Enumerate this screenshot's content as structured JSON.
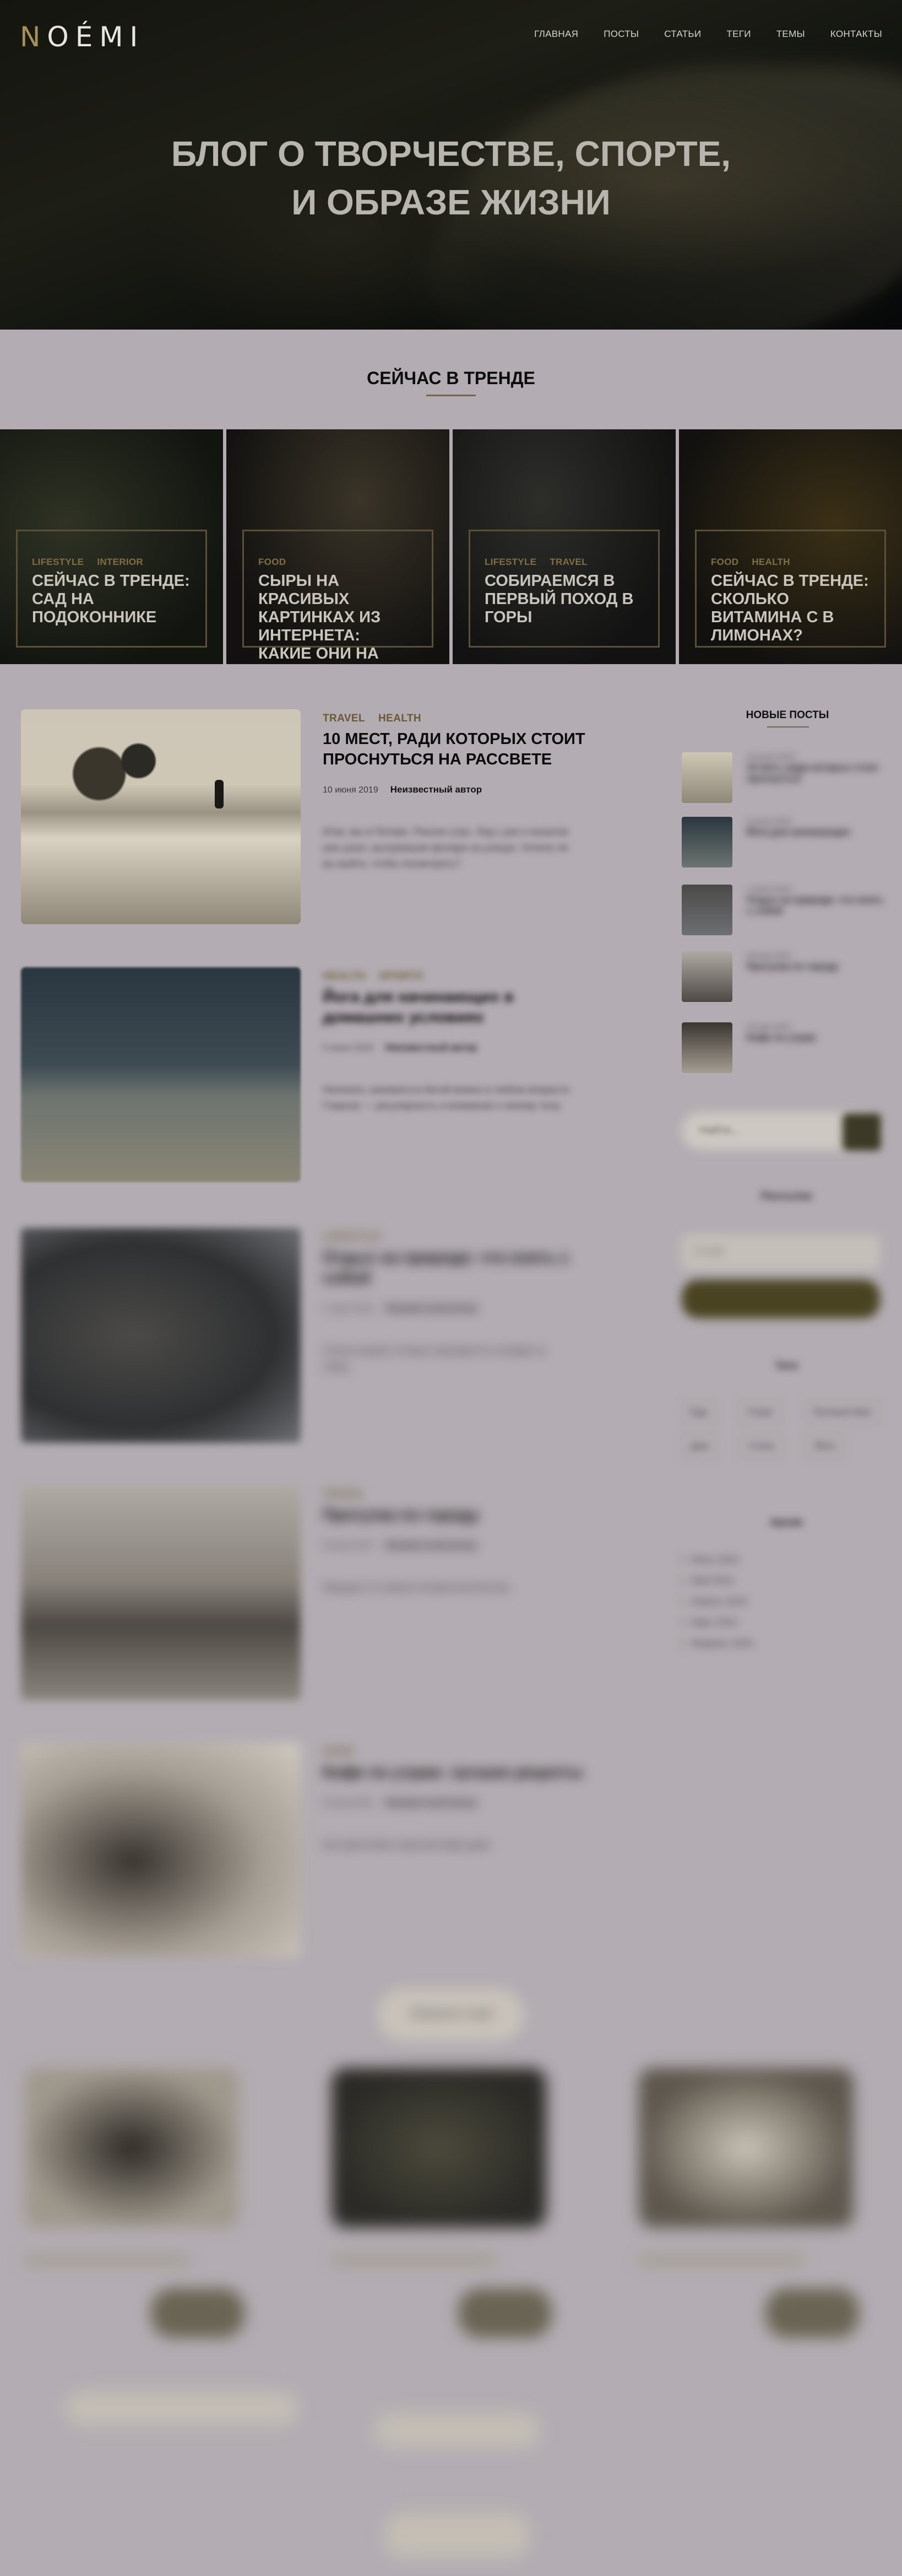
{
  "site": {
    "logo_first": "N",
    "logo_rest": "OÉMI"
  },
  "nav": [
    "ГЛАВНАЯ",
    "ПОСТЫ",
    "СТАТЬИ",
    "ТЕГИ",
    "ТЕМЫ",
    "КОНТАКТЫ"
  ],
  "hero": {
    "line1": "БЛОГ О ТВОРЧЕСТВЕ, СПОРТЕ,",
    "line2": "И ОБРАЗЕ ЖИЗНИ"
  },
  "trending": {
    "heading": "СЕЙЧАС В ТРЕНДЕ",
    "cards": [
      {
        "cats": [
          "LIFESTYLE",
          "INTERIOR"
        ],
        "title": "СЕЙЧАС В ТРЕНДЕ: САД НА ПОДОКОННИКЕ"
      },
      {
        "cats": [
          "FOOD"
        ],
        "title": "СЫРЫ НА КРАСИВЫХ КАРТИНКАХ ИЗ ИНТЕРНЕТА: КАКИЕ ОНИ НА ВКУС?"
      },
      {
        "cats": [
          "LIFESTYLE",
          "TRAVEL"
        ],
        "title": "СОБИРАЕМСЯ В ПЕРВЫЙ ПОХОД В ГОРЫ"
      },
      {
        "cats": [
          "FOOD",
          "HEALTH"
        ],
        "title": "СЕЙЧАС В ТРЕНДЕ: СКОЛЬКО ВИТАМИНА С В ЛИМОНАХ?"
      }
    ]
  },
  "posts": [
    {
      "cats": [
        "TRAVEL",
        "HEALTH"
      ],
      "title": "10 МЕСТ, РАДИ КОТОРЫХ СТОИТ ПРОСНУТЬСЯ НА РАССВЕТЕ",
      "date": "10 июня 2019",
      "author": "Неизвестный автор",
      "excerpt": "Итак, мы в Питере. Раннее утро. Лед с рек и каналов уже ушел, выгоревшие фонари на улицах. Успели ли вы выйти, чтобы посмотреть?"
    },
    {
      "cats": [
        "HEALTH",
        "SPORTS"
      ],
      "title": "Йога для начинающих в домашних условиях",
      "date": "5 июня 2019",
      "author": "Неизвестный автор",
      "excerpt": "Начинать заниматься йогой можно в любом возрасте. Главное — регулярность и внимание к своему телу."
    },
    {
      "cats": [
        "LIFESTYLE"
      ],
      "title": "Отдых на природе: что взять с собой",
      "date": "1 июня 2019",
      "author": "Неизвестный автор",
      "excerpt": "Список вещей, которые пригодятся в поездке за город."
    },
    {
      "cats": [
        "TRAVEL"
      ],
      "title": "Прогулка по городу",
      "date": "28 мая 2019",
      "author": "Неизвестный автор",
      "excerpt": "Маршрут по самым интересным местам."
    },
    {
      "cats": [
        "FOOD"
      ],
      "title": "Кофе по утрам: лучшие рецепты",
      "date": "20 мая 2019",
      "author": "Неизвестный автор",
      "excerpt": "Как приготовить вкусный кофе дома."
    }
  ],
  "sidebar": {
    "recent_heading": "НОВЫЕ ПОСТЫ",
    "recent": [
      {
        "date": "10 июня 2019",
        "title": "10 мест, ради которых стоит проснуться"
      },
      {
        "date": "5 июня 2019",
        "title": "Йога для начинающих"
      },
      {
        "date": "1 июня 2019",
        "title": "Отдых на природе: что взять с собой"
      },
      {
        "date": "28 мая 2019",
        "title": "Прогулка по городу"
      },
      {
        "date": "20 мая 2019",
        "title": "Кофе по утрам"
      }
    ],
    "search_placeholder": "Найти...",
    "subscribe_heading": "Рассылка",
    "subscribe_placeholder": "E-mail",
    "tags_heading": "Теги",
    "tags": [
      "Еда",
      "Спорт",
      "Путешествия",
      "Дом",
      "Стиль",
      "Йога"
    ],
    "archive_heading": "Архив",
    "archive": [
      "Июнь 2019",
      "Май 2019",
      "Апрель 2019",
      "Март 2019",
      "Февраль 2019"
    ]
  },
  "load_more": "Загрузить ещё"
}
